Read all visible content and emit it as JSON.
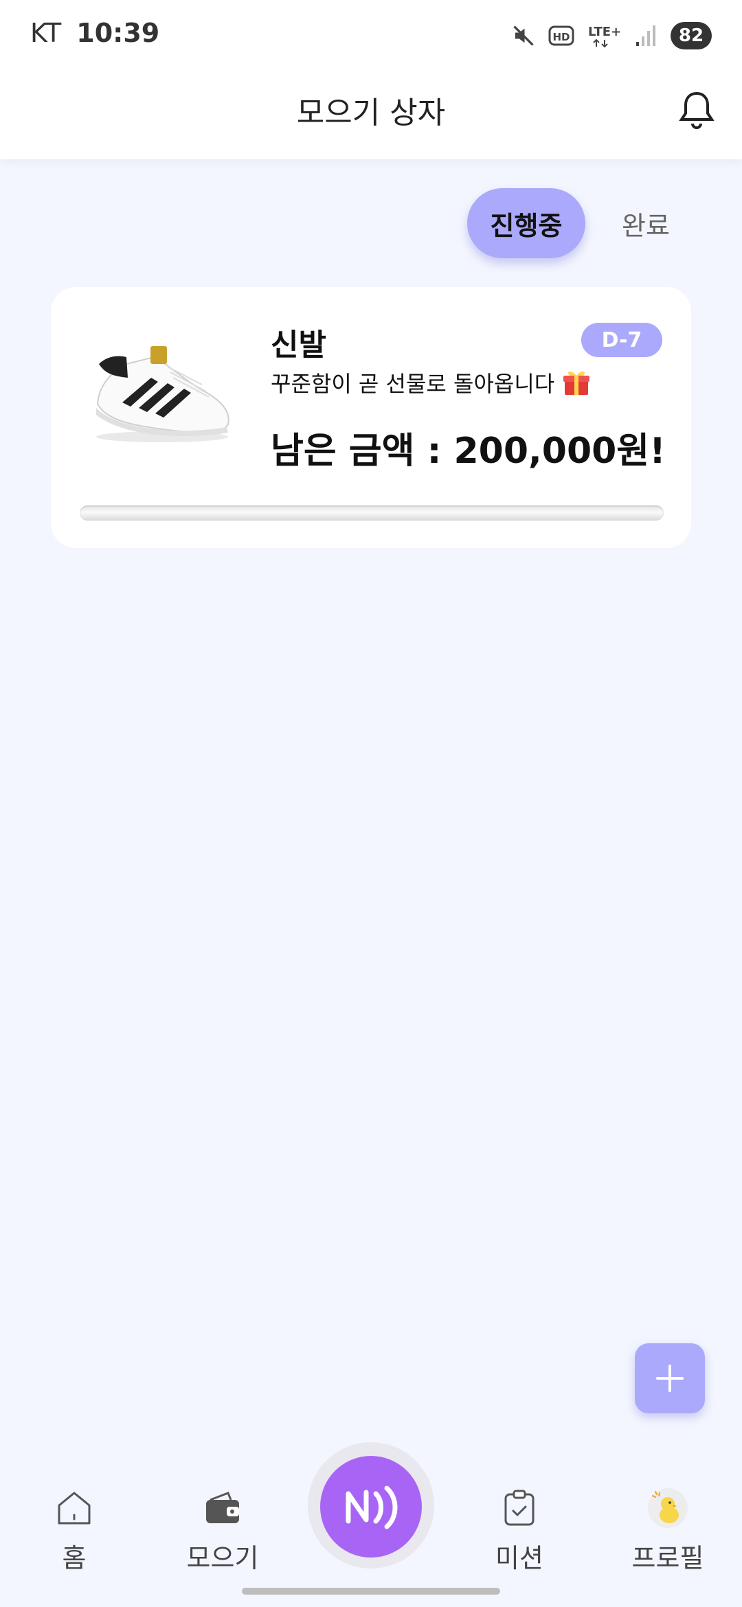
{
  "status_bar": {
    "carrier": "KT",
    "time": "10:39",
    "battery": "82",
    "icons": [
      "mute-icon",
      "hd-icon",
      "lte-icon",
      "signal-icon"
    ]
  },
  "header": {
    "title": "모으기 상자",
    "bell_icon": "bell-icon"
  },
  "filter_tabs": {
    "active": "진행중",
    "inactive": "완료"
  },
  "goal_card": {
    "title": "신발",
    "dday": "D-7",
    "subtitle": "꾸준함이 곧 선물로 돌아옵니다",
    "amount": "남은 금액 : 200,000원!",
    "progress": 0,
    "image": "sneaker-image",
    "gift_icon": "gift-icon"
  },
  "fab": {
    "icon": "plus-icon"
  },
  "bottom_nav": {
    "items": [
      {
        "label": "홈",
        "icon": "home-icon"
      },
      {
        "label": "모으기",
        "icon": "wallet-icon"
      },
      {
        "label": "미션",
        "icon": "clipboard-icon"
      },
      {
        "label": "프로필",
        "icon": "chick-avatar-icon"
      }
    ],
    "center_icon": "nfc-pay-icon"
  },
  "colors": {
    "accent": "#ABA9FB",
    "center_button": "#A865F5",
    "background": "#F3F6FE"
  }
}
